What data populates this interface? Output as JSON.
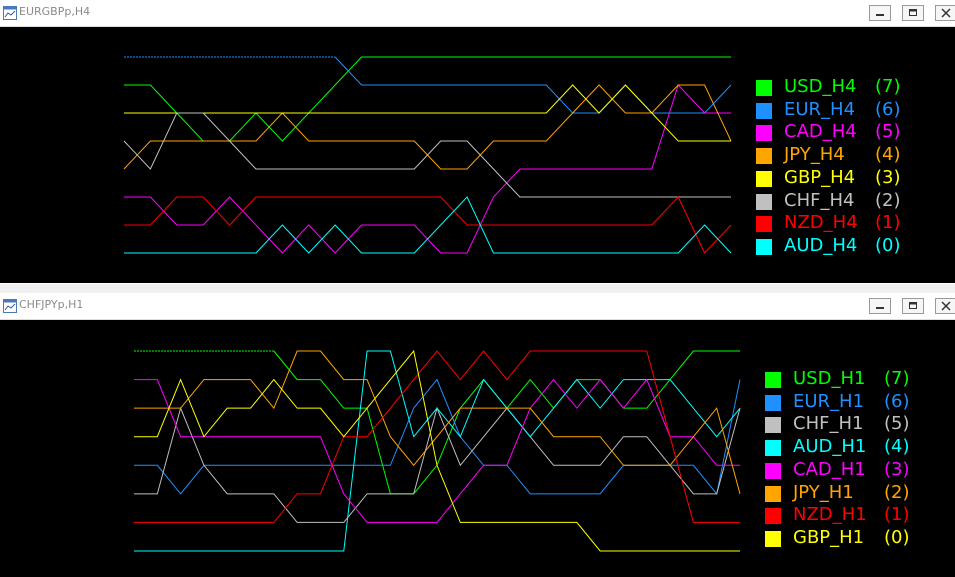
{
  "windows": [
    {
      "title": "EURGBPp,H4",
      "controls": [
        "minimize",
        "restore",
        "close"
      ],
      "chart_data": {
        "type": "line",
        "y_meaning": "rank",
        "ylim": [
          0,
          7
        ],
        "x": [
          0,
          1,
          2,
          3,
          4,
          5,
          6,
          7,
          8,
          9,
          10,
          11,
          12,
          13,
          14,
          15,
          16,
          17,
          18,
          19,
          20,
          21,
          22,
          23
        ],
        "series": [
          {
            "name": "USD_H4",
            "rank": "(7)",
            "color": "#00ff00",
            "dashed_start": false,
            "values": [
              6,
              6,
              5,
              4,
              4,
              5,
              4,
              5,
              6,
              7,
              7,
              7,
              7,
              7,
              7,
              7,
              7,
              7,
              7,
              7,
              7,
              7,
              7,
              7
            ]
          },
          {
            "name": "EUR_H4",
            "rank": "(6)",
            "color": "#1e90ff",
            "dashed_start": true,
            "values": [
              7,
              7,
              7,
              7,
              7,
              7,
              7,
              7,
              7,
              6,
              6,
              6,
              6,
              6,
              6,
              6,
              6,
              5,
              5,
              6,
              5,
              5,
              5,
              6
            ]
          },
          {
            "name": "CAD_H4",
            "rank": "(5)",
            "color": "#ff00ff",
            "dashed_start": false,
            "values": [
              2,
              2,
              1,
              1,
              2,
              1,
              0,
              1,
              0,
              1,
              1,
              1,
              0,
              0,
              2,
              3,
              3,
              3,
              3,
              3,
              3,
              6,
              5,
              5
            ]
          },
          {
            "name": "JPY_H4",
            "rank": "(4)",
            "color": "#ffa500",
            "dashed_start": false,
            "values": [
              3,
              4,
              4,
              4,
              4,
              4,
              5,
              4,
              4,
              4,
              4,
              4,
              3,
              3,
              4,
              4,
              4,
              5,
              6,
              5,
              5,
              6,
              6,
              4
            ]
          },
          {
            "name": "GBP_H4",
            "rank": "(3)",
            "color": "#ffff00",
            "dashed_start": false,
            "values": [
              5,
              5,
              5,
              5,
              5,
              5,
              5,
              5,
              5,
              5,
              5,
              5,
              5,
              5,
              5,
              5,
              5,
              6,
              5,
              6,
              5,
              4,
              4,
              4
            ]
          },
          {
            "name": "CHF_H4",
            "rank": "(2)",
            "color": "#c0c0c0",
            "dashed_start": false,
            "values": [
              4,
              3,
              5,
              5,
              4,
              3,
              3,
              3,
              3,
              3,
              3,
              3,
              4,
              4,
              3,
              2,
              2,
              2,
              2,
              2,
              2,
              2,
              2,
              2
            ]
          },
          {
            "name": "NZD_H4",
            "rank": "(1)",
            "color": "#ff0000",
            "dashed_start": false,
            "values": [
              1,
              1,
              2,
              2,
              1,
              2,
              2,
              2,
              2,
              2,
              2,
              2,
              2,
              1,
              1,
              1,
              1,
              1,
              1,
              1,
              1,
              2,
              0,
              1
            ]
          },
          {
            "name": "AUD_H4",
            "rank": "(0)",
            "color": "#00ffff",
            "dashed_start": false,
            "values": [
              0,
              0,
              0,
              0,
              0,
              0,
              1,
              0,
              1,
              0,
              0,
              0,
              1,
              2,
              0,
              0,
              0,
              0,
              0,
              0,
              0,
              0,
              1,
              0
            ]
          }
        ]
      }
    },
    {
      "title": "CHFJPYp,H1",
      "controls": [
        "minimize",
        "restore",
        "close"
      ],
      "chart_data": {
        "type": "line",
        "y_meaning": "rank",
        "ylim": [
          0,
          7
        ],
        "x": [
          0,
          1,
          2,
          3,
          4,
          5,
          6,
          7,
          8,
          9,
          10,
          11,
          12,
          13,
          14,
          15,
          16,
          17,
          18,
          19,
          20,
          21,
          22,
          23,
          24,
          25,
          26
        ],
        "series": [
          {
            "name": "USD_H1",
            "rank": "(7)",
            "color": "#00ff00",
            "dashed_start": true,
            "values": [
              7,
              7,
              7,
              7,
              7,
              7,
              7,
              6,
              6,
              5,
              5,
              2,
              2,
              3,
              5,
              6,
              5,
              6,
              5,
              6,
              6,
              5,
              5,
              6,
              7,
              7,
              7
            ]
          },
          {
            "name": "EUR_H1",
            "rank": "(6)",
            "color": "#1e90ff",
            "dashed_start": false,
            "values": [
              3,
              3,
              2,
              3,
              3,
              3,
              3,
              3,
              3,
              3,
              3,
              3,
              5,
              6,
              4,
              3,
              3,
              2,
              2,
              2,
              2,
              3,
              3,
              3,
              3,
              2,
              6
            ]
          },
          {
            "name": "CHF_H1",
            "rank": "(5)",
            "color": "#c0c0c0",
            "dashed_start": false,
            "values": [
              2,
              2,
              5,
              3,
              2,
              2,
              2,
              1,
              1,
              1,
              2,
              2,
              2,
              5,
              3,
              4,
              5,
              4,
              3,
              3,
              3,
              4,
              4,
              3,
              2,
              2,
              5
            ]
          },
          {
            "name": "AUD_H1",
            "rank": "(4)",
            "color": "#00ffff",
            "dashed_start": false,
            "values": [
              0,
              0,
              0,
              0,
              0,
              0,
              0,
              0,
              0,
              0,
              7,
              7,
              4,
              5,
              4,
              6,
              5,
              4,
              5,
              6,
              5,
              6,
              6,
              6,
              5,
              4,
              5
            ]
          },
          {
            "name": "CAD_H1",
            "rank": "(3)",
            "color": "#ff00ff",
            "dashed_start": false,
            "values": [
              6,
              6,
              4,
              4,
              4,
              4,
              4,
              4,
              4,
              2,
              1,
              1,
              1,
              1,
              2,
              3,
              3,
              5,
              6,
              5,
              6,
              5,
              6,
              4,
              4,
              3,
              3
            ]
          },
          {
            "name": "JPY_H1",
            "rank": "(2)",
            "color": "#ffa500",
            "dashed_start": false,
            "values": [
              5,
              5,
              5,
              6,
              6,
              6,
              5,
              7,
              7,
              6,
              6,
              4,
              3,
              4,
              5,
              5,
              5,
              5,
              4,
              4,
              4,
              3,
              3,
              3,
              4,
              5,
              2
            ]
          },
          {
            "name": "NZD_H1",
            "rank": "(1)",
            "color": "#ff0000",
            "dashed_start": false,
            "values": [
              1,
              1,
              1,
              1,
              1,
              1,
              1,
              2,
              2,
              4,
              4,
              5,
              6,
              7,
              6,
              7,
              6,
              7,
              7,
              7,
              7,
              7,
              7,
              4,
              1,
              1,
              1
            ]
          },
          {
            "name": "GBP_H1",
            "rank": "(0)",
            "color": "#ffff00",
            "dashed_start": false,
            "values": [
              4,
              4,
              6,
              4,
              5,
              5,
              6,
              5,
              5,
              4,
              5,
              6,
              7,
              3,
              1,
              1,
              1,
              1,
              1,
              1,
              0,
              0,
              0,
              0,
              0,
              0,
              0
            ]
          }
        ]
      }
    }
  ]
}
